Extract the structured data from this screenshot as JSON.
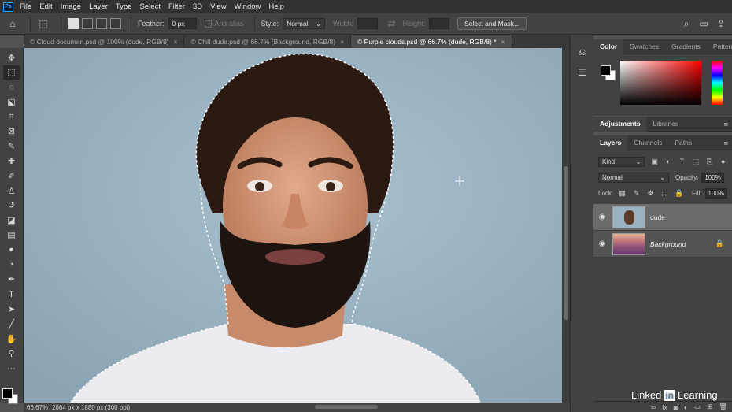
{
  "menu": {
    "logo": "Ps",
    "items": [
      "File",
      "Edit",
      "Image",
      "Layer",
      "Type",
      "Select",
      "Filter",
      "3D",
      "View",
      "Window",
      "Help"
    ]
  },
  "options": {
    "feather_label": "Feather:",
    "feather_value": "0 px",
    "antialias_label": "Anti-alias",
    "style_label": "Style:",
    "style_value": "Normal",
    "width_label": "Width:",
    "height_label": "Height:",
    "select_mask_label": "Select and Mask..."
  },
  "tabs": [
    {
      "label": "Cloud documan.psd @ 100% (dude, RGB/8)"
    },
    {
      "label": "Chill dude.psd @ 66.7% (Background, RGB/8)"
    },
    {
      "label": "Purple clouds.psd @ 66.7% (dude, RGB/8) *"
    }
  ],
  "tab_close": "×",
  "tab_prefix": "©",
  "status": {
    "zoom": "66.67%",
    "info": "2864 px x 1880 px (300 ppi)"
  },
  "color_panel": {
    "tabs": [
      "Color",
      "Swatches",
      "Gradients",
      "Patterns"
    ]
  },
  "adjust_panel": {
    "tabs": [
      "Adjustments",
      "Libraries"
    ]
  },
  "layers_panel": {
    "tabs": [
      "Layers",
      "Channels",
      "Paths"
    ],
    "filter_label": "Kind",
    "blend_mode": "Normal",
    "opacity_label": "Opacity:",
    "opacity_value": "100%",
    "lock_label": "Lock:",
    "fill_label": "Fill:",
    "fill_value": "100%",
    "layers": [
      {
        "name": "dude",
        "active": true
      },
      {
        "name": "Background",
        "active": false
      }
    ],
    "footer_fx": "fx"
  },
  "watermark": {
    "left": "Linked",
    "in": "in",
    "right": "Learning"
  },
  "colors": {
    "canvas_bg": "#9ab3c2",
    "fg": "#000000",
    "bg": "#ffffff"
  }
}
